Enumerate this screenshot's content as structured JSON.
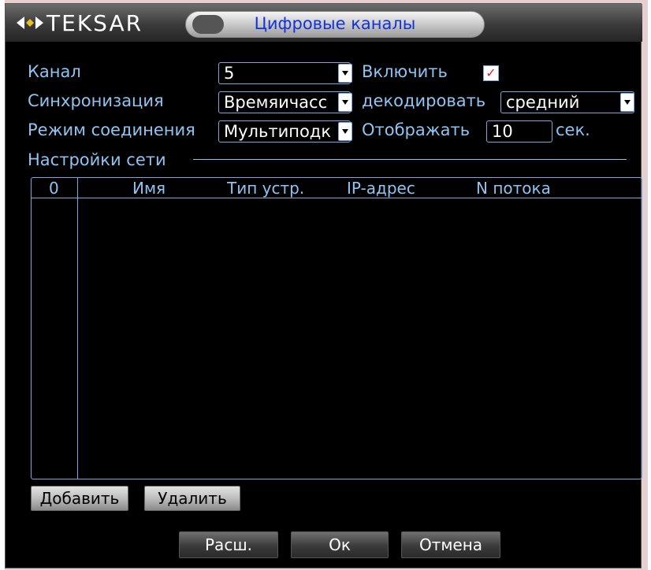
{
  "header": {
    "logo": "TEKSAR",
    "title": "Цифровые каналы"
  },
  "form": {
    "channel_label": "Канал",
    "channel_value": "5",
    "enable_label": "Включить",
    "enable_checked": true,
    "sync_label": "Синхронизация",
    "sync_value": "Времяичасс",
    "decode_label": "декодировать",
    "decode_value": "средний",
    "conn_label": "Режим соединения",
    "conn_value": "Мультиподк",
    "display_label": "Отображать",
    "display_value": "10",
    "display_unit": "сек."
  },
  "network": {
    "section_title": "Настройки сети",
    "columns": [
      "0",
      "Имя",
      "Тип устр.",
      "IP-адрес",
      "N потока"
    ],
    "rows": []
  },
  "actions": {
    "add": "Добавить",
    "remove": "Удалить",
    "advanced": "Расш.",
    "ok": "Ок",
    "cancel": "Отмена"
  },
  "colors": {
    "label": "#8ec4f2",
    "title_text": "#1233d8",
    "check": "#e0202a",
    "background": "#000000"
  }
}
